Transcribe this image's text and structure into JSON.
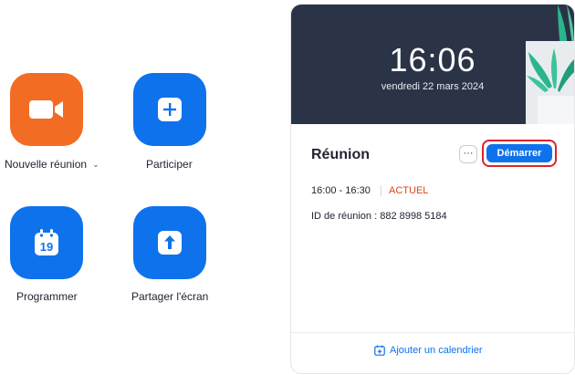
{
  "actions": {
    "new_meeting": {
      "label": "Nouvelle réunion",
      "icon": "video-camera-icon",
      "color": "#f36c24"
    },
    "join": {
      "label": "Participer",
      "icon": "plus-icon",
      "color": "#0e72ed"
    },
    "schedule": {
      "label": "Programmer",
      "icon": "calendar-icon",
      "calendar_day": "19",
      "color": "#0e72ed"
    },
    "share_screen": {
      "label": "Partager l'écran",
      "icon": "upload-arrow-icon",
      "color": "#0e72ed"
    }
  },
  "card": {
    "time": "16:06",
    "date": "vendredi 22 mars 2024",
    "meeting": {
      "title": "Réunion",
      "more_label": "···",
      "start_label": "Démarrer",
      "time_range": "16:00 - 16:30",
      "status": "ACTUEL",
      "meeting_id": "ID de réunion : 882 8998 5184"
    },
    "footer": {
      "add_calendar_label": "Ajouter un calendrier",
      "icon": "calendar-add-icon"
    }
  },
  "colors": {
    "header_background": "#2b3447",
    "accent_blue": "#0e72ed",
    "accent_orange": "#f36c24",
    "status_red": "#e0421b",
    "highlight_ring": "#d9242b"
  }
}
